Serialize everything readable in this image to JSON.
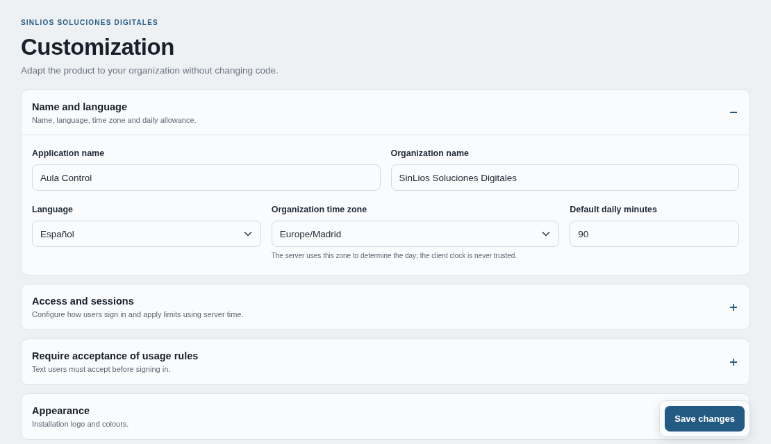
{
  "eyebrow": "SINLIOS SOLUCIONES DIGITALES",
  "title": "Customization",
  "subtitle": "Adapt the product to your organization without changing code.",
  "sections": [
    {
      "title": "Name and language",
      "description": "Name, language, time zone and daily allowance.",
      "expanded": true,
      "rows": [
        {
          "fields": [
            {
              "kind": "text",
              "label": "Application name",
              "value": "Aula Control"
            },
            {
              "kind": "text",
              "label": "Organization name",
              "value": "SinLios Soluciones Digitales"
            }
          ]
        },
        {
          "fields": [
            {
              "kind": "select",
              "label": "Language",
              "value": "Español"
            },
            {
              "kind": "select",
              "label": "Organization time zone",
              "value": "Europe/Madrid",
              "hint": "The server uses this zone to determine the day; the client clock is never trusted."
            },
            {
              "kind": "text",
              "label": "Default daily minutes",
              "value": "90"
            }
          ]
        }
      ]
    },
    {
      "title": "Access and sessions",
      "description": "Configure how users sign in and apply limits using server time.",
      "expanded": false
    },
    {
      "title": "Require acceptance of usage rules",
      "description": "Text users must accept before signing in.",
      "expanded": false
    },
    {
      "title": "Appearance",
      "description": "Installation logo and colours."
    }
  ],
  "save_button": "Save changes"
}
